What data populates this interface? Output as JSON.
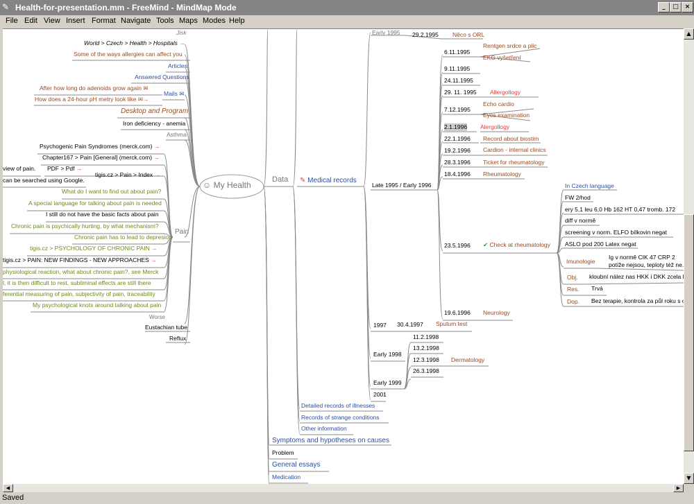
{
  "window": {
    "title": "Health-for-presentation.mm - FreeMind - MindMap Mode",
    "minimize": "_",
    "maximize": "□",
    "close": "×"
  },
  "menu": [
    "File",
    "Edit",
    "View",
    "Insert",
    "Format",
    "Navigate",
    "Tools",
    "Maps",
    "Modes",
    "Help"
  ],
  "status": "Saved",
  "root": "My Health",
  "left": {
    "top_misc": [
      "Jisk",
      "Some of the ways allergies can affect you"
    ],
    "breadcrumb": "World > Czech > Health > Hospitals",
    "articles": "Articles",
    "answered": "Answered Questions",
    "mails": "Mails",
    "mail1": "After how long do adenoids grow again",
    "mail2": "How does a 24-hour pH metry look like",
    "desktop": "Desktop and Program",
    "iron": "Iron deficiency - anemia",
    "asthma": "Asthma",
    "pain": "Pain",
    "pain_items": [
      "Psychogenic Pain Syndromes (merck.com)",
      "Chapter167  > Pain [General] (merck.com)",
      "PDF > Pdf",
      "tigis.cz > Pain > Index",
      "What do I want to find out about pain?",
      "A special language for talking about pain is needed",
      "I still do not have the basic facts about pain",
      "Chronic pain is psychically hurting, by what mechanism?",
      "Chronic pain has to lead to depresion",
      "tigis.cz > PSYCHOLOGY OF CHRONIC PAIN",
      "tigis.cz > PAIN: NEW FINDINGS - NEW APPROACHES",
      "physiological reaction, what about chronic pain?, see Merck",
      "l, it is then difficult to rest, subliminal effects are still there",
      "ferential measuring of pain, subjectivity of pain, traceability",
      "My psychological knots around talking about pain"
    ],
    "pain_cut": [
      "view of pain.",
      "can be searched using Google."
    ],
    "worse": "Worse",
    "eustachian": "Eustachian tube",
    "reflux": "Reflux"
  },
  "right": {
    "data": "Data",
    "medical_records": "Medical records",
    "early1995": "Early 1995",
    "d_29_2_1995": "29.2.1995",
    "neco_orl": "Něco s ORL",
    "late1995": "Late 1995 / Early 1996",
    "dates": [
      {
        "d": "6.11.1995",
        "n": [
          "Rentgen srdce a plic",
          "EKG vyšetření"
        ]
      },
      {
        "d": "9.11.1995",
        "n": []
      },
      {
        "d": "24.11.1995",
        "n": []
      },
      {
        "d": "29. 11. 1995",
        "n": [
          "Allergollogy"
        ]
      },
      {
        "d": "7.12.1995",
        "n": [
          "Echo cardio",
          "Eyes examination"
        ]
      },
      {
        "d": "2.1.1996",
        "n": [
          "Alergollogy"
        ]
      },
      {
        "d": "22.1.1996",
        "n": [
          "Record about biostim"
        ]
      },
      {
        "d": "19.2.1996",
        "n": [
          "Cardion  - internal clinics"
        ]
      },
      {
        "d": "28.3.1996",
        "n": [
          "Ticket for rheumatology"
        ]
      },
      {
        "d": "18.4.1996",
        "n": [
          "Rheumatology"
        ]
      }
    ],
    "d_23_5_1996": "23.5.1996",
    "check_rheum": "Check at rheumatology",
    "rheum_details": [
      "In Czech language",
      "FW 2/hod",
      "ery 5,1 leu 6,0 Hb 162 HT 0,47 tromb. 172",
      "diff v normě",
      "screening v norm. ELFO bílkovin negat",
      "ASLO pod 200 Latex negat"
    ],
    "imunologie": "Imunologie",
    "imuno_text1": "Ig v normě  CIK 47  CRP 2",
    "imuno_text2": "potíže nejsou, teploty též ne.",
    "obj": "Obj.",
    "obj_text": "kloubní nález nas HKK i DKK zcela k",
    "res": "Res.",
    "res_text": "Trvá",
    "dop": "Dop.",
    "dop_text": "Bez terapie, kontrola za půl roku s o",
    "d_19_6_1996": "19.6.1996",
    "neurology": "Neurology",
    "y1997": "1997",
    "d_30_4_1997": "30.4.1997",
    "sputum": "Sputum test",
    "early1998": "Early 1998",
    "dates98": [
      "11.2.1998",
      "13.2.1998",
      "12.3.1998",
      "26.3.1998"
    ],
    "dermatology": "Dermatology",
    "early1999": "Early 1999",
    "y2001": "2001",
    "detailed": "Detailed records of illnesses",
    "strange": "Records of strange conditions",
    "other": "Other information",
    "symptoms": "Symptoms and hypotheses on causes",
    "problem": "Problem",
    "essays": "General essays",
    "medication": "Medication"
  }
}
